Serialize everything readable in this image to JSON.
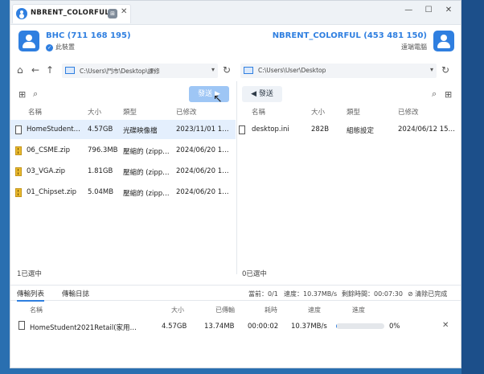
{
  "window": {
    "tab_title": "NBRENT_COLORFUL",
    "controls": [
      "—",
      "☐",
      "✕"
    ]
  },
  "local": {
    "name": "BHC (711 168 195)",
    "label": "此裝置",
    "path": "C:\\Users\\鬥市\\Desktop\\課修",
    "send_label": "發送",
    "columns": [
      "名稱",
      "大小",
      "類型",
      "已修改"
    ],
    "files": [
      {
        "name": "HomeStudent…",
        "size": "4.57GB",
        "type": "光碟映像檔",
        "modified": "2023/11/01 1…",
        "icon": "doc-icon"
      },
      {
        "name": "06_CSME.zip",
        "size": "796.3MB",
        "type": "壓縮的 (zipp…",
        "modified": "2024/06/20 1…",
        "icon": "zip-icon"
      },
      {
        "name": "03_VGA.zip",
        "size": "1.81GB",
        "type": "壓縮的 (zipp…",
        "modified": "2024/06/20 1…",
        "icon": "zip-icon"
      },
      {
        "name": "01_Chipset.zip",
        "size": "5.04MB",
        "type": "壓縮的 (zipp…",
        "modified": "2024/06/20 1…",
        "icon": "zip-icon"
      }
    ],
    "status": "1已選中"
  },
  "remote": {
    "name": "NBRENT_COLORFUL (453 481 150)",
    "label": "遠端電腦",
    "path": "C:\\Users\\User\\Desktop",
    "recv_label": "發送",
    "columns": [
      "名稱",
      "大小",
      "類型",
      "已修改"
    ],
    "files": [
      {
        "name": "desktop.ini",
        "size": "282B",
        "type": "組態設定",
        "modified": "2024/06/12 15…",
        "icon": "doc-icon"
      }
    ],
    "status": "0已選中"
  },
  "transfer": {
    "tabs": [
      "傳輸列表",
      "傳輸日誌"
    ],
    "current": "當前：0/1",
    "speed": "速度：10.37MB/s",
    "remaining": "剩餘時間：00:07:30",
    "clear_label": "清除已完成",
    "columns": [
      "名稱",
      "大小",
      "已傳輸",
      "耗時",
      "速度",
      "進度"
    ],
    "rows": [
      {
        "name": "HomeStudent2021Retail(家用…",
        "size": "4.57GB",
        "transferred": "13.74MB",
        "elapsed": "00:00:02",
        "speed": "10.37MB/s",
        "progress_text": "0%",
        "progress_fraction": 0.003
      }
    ]
  },
  "colors": {
    "accent": "#2f7fe0",
    "selected_row": "#e4effd"
  }
}
